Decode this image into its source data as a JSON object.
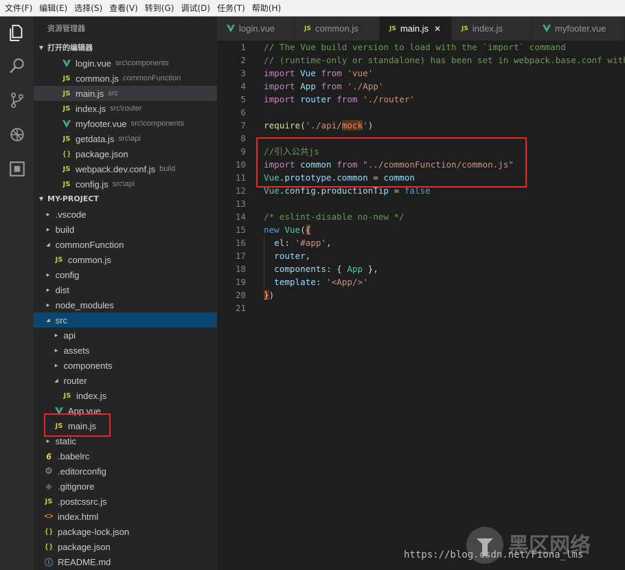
{
  "menu": [
    "文件(F)",
    "编辑(E)",
    "选择(S)",
    "查看(V)",
    "转到(G)",
    "调试(D)",
    "任务(T)",
    "帮助(H)"
  ],
  "sidebar": {
    "title": "资源管理器",
    "open_editors_title": "打开的编辑器",
    "open_editors": [
      {
        "type": "vue",
        "name": "login.vue",
        "path": "src\\components"
      },
      {
        "type": "js",
        "name": "common.js",
        "path": "commonFunction"
      },
      {
        "type": "js",
        "name": "main.js",
        "path": "src"
      },
      {
        "type": "js",
        "name": "index.js",
        "path": "src\\router"
      },
      {
        "type": "vue",
        "name": "myfooter.vue",
        "path": "src\\components"
      },
      {
        "type": "js",
        "name": "getdata.js",
        "path": "src\\api"
      },
      {
        "type": "json",
        "name": "package.json",
        "path": ""
      },
      {
        "type": "js",
        "name": "webpack.dev.conf.js",
        "path": "build"
      },
      {
        "type": "js",
        "name": "config.js",
        "path": "src\\api"
      }
    ],
    "project_title": "MY-PROJECT",
    "tree": [
      {
        "kind": "folder",
        "open": false,
        "depth": 0,
        "name": ".vscode"
      },
      {
        "kind": "folder",
        "open": false,
        "depth": 0,
        "name": "build"
      },
      {
        "kind": "folder",
        "open": true,
        "depth": 0,
        "name": "commonFunction"
      },
      {
        "kind": "file",
        "type": "js",
        "depth": 1,
        "name": "common.js"
      },
      {
        "kind": "folder",
        "open": false,
        "depth": 0,
        "name": "config"
      },
      {
        "kind": "folder",
        "open": false,
        "depth": 0,
        "name": "dist"
      },
      {
        "kind": "folder",
        "open": false,
        "depth": 0,
        "name": "node_modules"
      },
      {
        "kind": "folder",
        "open": true,
        "depth": 0,
        "name": "src",
        "active": true
      },
      {
        "kind": "folder",
        "open": false,
        "depth": 1,
        "name": "api"
      },
      {
        "kind": "folder",
        "open": false,
        "depth": 1,
        "name": "assets"
      },
      {
        "kind": "folder",
        "open": false,
        "depth": 1,
        "name": "components"
      },
      {
        "kind": "folder",
        "open": true,
        "depth": 1,
        "name": "router"
      },
      {
        "kind": "file",
        "type": "js",
        "depth": 2,
        "name": "index.js"
      },
      {
        "kind": "file",
        "type": "vue",
        "depth": 1,
        "name": "App.vue"
      },
      {
        "kind": "file",
        "type": "js",
        "depth": 1,
        "name": "main.js"
      },
      {
        "kind": "folder",
        "open": false,
        "depth": 0,
        "name": "static"
      },
      {
        "kind": "file",
        "type": "babel",
        "depth": 0,
        "name": ".babelrc"
      },
      {
        "kind": "file",
        "type": "gear",
        "depth": 0,
        "name": ".editorconfig"
      },
      {
        "kind": "file",
        "type": "git",
        "depth": 0,
        "name": ".gitignore"
      },
      {
        "kind": "file",
        "type": "js",
        "depth": 0,
        "name": ".postcssrc.js"
      },
      {
        "kind": "file",
        "type": "html",
        "depth": 0,
        "name": "index.html"
      },
      {
        "kind": "file",
        "type": "json",
        "depth": 0,
        "name": "package-lock.json"
      },
      {
        "kind": "file",
        "type": "json",
        "depth": 0,
        "name": "package.json"
      },
      {
        "kind": "file",
        "type": "info",
        "depth": 0,
        "name": "README.md"
      }
    ]
  },
  "tabs": [
    {
      "type": "vue",
      "label": "login.vue",
      "active": false
    },
    {
      "type": "js",
      "label": "common.js",
      "active": false
    },
    {
      "type": "js",
      "label": "main.js",
      "active": true
    },
    {
      "type": "js",
      "label": "index.js",
      "active": false
    },
    {
      "type": "vue",
      "label": "myfooter.vue",
      "active": false
    }
  ],
  "icons": {
    "js": "JS",
    "json": "{ }",
    "babel": "6",
    "html": "<>",
    "activity": [
      "explorer-icon",
      "search-icon",
      "source-control-icon",
      "debug-icon",
      "extensions-icon"
    ]
  },
  "code_lines": [
    [
      [
        "cm",
        "// The Vue build version to load with the `import` command"
      ]
    ],
    [
      [
        "cm",
        "// (runtime-only or standalone) has been set in webpack.base.conf with an alias."
      ]
    ],
    [
      [
        "kw",
        "import"
      ],
      [
        "pl",
        " "
      ],
      [
        "id",
        "Vue"
      ],
      [
        "pl",
        " "
      ],
      [
        "kw",
        "from"
      ],
      [
        "pl",
        " "
      ],
      [
        "st",
        "'vue'"
      ]
    ],
    [
      [
        "kw",
        "import"
      ],
      [
        "pl",
        " "
      ],
      [
        "id",
        "App"
      ],
      [
        "pl",
        " "
      ],
      [
        "kw",
        "from"
      ],
      [
        "pl",
        " "
      ],
      [
        "st",
        "'./App'"
      ]
    ],
    [
      [
        "kw",
        "import"
      ],
      [
        "pl",
        " "
      ],
      [
        "id",
        "router"
      ],
      [
        "pl",
        " "
      ],
      [
        "kw",
        "from"
      ],
      [
        "pl",
        " "
      ],
      [
        "st",
        "'./router'"
      ]
    ],
    [],
    [
      [
        "fn",
        "require"
      ],
      [
        "pl",
        "("
      ],
      [
        "st",
        "'./api/"
      ],
      [
        "sthl",
        "mock"
      ],
      [
        "st",
        "'"
      ],
      [
        "pl",
        ")"
      ]
    ],
    [],
    [
      [
        "cm",
        "//引入公共js"
      ]
    ],
    [
      [
        "kw",
        "import"
      ],
      [
        "pl",
        " "
      ],
      [
        "id",
        "common"
      ],
      [
        "pl",
        " "
      ],
      [
        "kw",
        "from"
      ],
      [
        "pl",
        " "
      ],
      [
        "st",
        "\"../commonFunction/common.js\""
      ]
    ],
    [
      [
        "cl",
        "Vue"
      ],
      [
        "pl",
        "."
      ],
      [
        "id",
        "prototype"
      ],
      [
        "pl",
        "."
      ],
      [
        "id",
        "common"
      ],
      [
        "pl",
        " = "
      ],
      [
        "id",
        "common"
      ]
    ],
    [
      [
        "cl",
        "Vue"
      ],
      [
        "pl",
        "."
      ],
      [
        "id",
        "config"
      ],
      [
        "pl",
        "."
      ],
      [
        "id",
        "productionTip"
      ],
      [
        "pl",
        " = "
      ],
      [
        "bl",
        "false"
      ]
    ],
    [],
    [
      [
        "cm",
        "/* eslint-disable no-new */"
      ]
    ],
    [
      [
        "bl",
        "new"
      ],
      [
        "pl",
        " "
      ],
      [
        "cl",
        "Vue"
      ],
      [
        "pl",
        "("
      ],
      [
        "plhl",
        "{"
      ]
    ],
    [
      [
        "pl",
        "  "
      ],
      [
        "id",
        "el"
      ],
      [
        "pl",
        ": "
      ],
      [
        "st",
        "'#app'"
      ],
      [
        "pl",
        ","
      ]
    ],
    [
      [
        "pl",
        "  "
      ],
      [
        "id",
        "router"
      ],
      [
        "pl",
        ","
      ]
    ],
    [
      [
        "pl",
        "  "
      ],
      [
        "id",
        "components"
      ],
      [
        "pl",
        ": { "
      ],
      [
        "cl",
        "App"
      ],
      [
        "pl",
        " },"
      ]
    ],
    [
      [
        "pl",
        "  "
      ],
      [
        "id",
        "template"
      ],
      [
        "pl",
        ": "
      ],
      [
        "st",
        "'<App/>'"
      ]
    ],
    [
      [
        "plhl",
        "}"
      ],
      [
        "pl",
        ")"
      ]
    ],
    []
  ],
  "watermark": "https://blog.csdn.net/Fiona_lms",
  "watermark_logo": "黑区网络"
}
